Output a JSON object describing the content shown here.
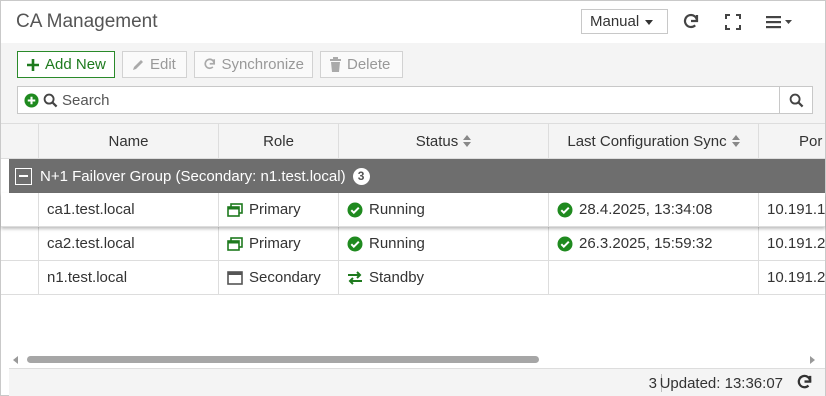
{
  "header": {
    "title": "CA Management",
    "mode_selected": "Manual",
    "icons": [
      "refresh-icon",
      "fullscreen-icon",
      "menu-icon"
    ]
  },
  "toolbar": {
    "add_label": "Add New",
    "edit_label": "Edit",
    "sync_label": "Synchronize",
    "delete_label": "Delete",
    "search_placeholder": "Search"
  },
  "table": {
    "columns": [
      "Name",
      "Role",
      "Status",
      "Last Configuration Sync",
      "Por"
    ],
    "group": {
      "label": "N+1 Failover Group (Secondary: n1.test.local)",
      "count": "3"
    },
    "rows": [
      {
        "name": "ca1.test.local",
        "role": "Primary",
        "role_icon": "windows-stack-icon",
        "status": "Running",
        "status_icon": "check-circle-icon",
        "sync": "28.4.2025, 13:34:08",
        "port": "10.191.1"
      },
      {
        "name": "ca2.test.local",
        "role": "Primary",
        "role_icon": "windows-stack-icon",
        "status": "Running",
        "status_icon": "check-circle-icon",
        "sync": "26.3.2025, 15:59:32",
        "port": "10.191.2"
      },
      {
        "name": "n1.test.local",
        "role": "Secondary",
        "role_icon": "window-icon",
        "status": "Standby",
        "status_icon": "swap-arrows-icon",
        "sync": "",
        "port": "10.191.2"
      }
    ]
  },
  "footer": {
    "count": "3",
    "updated": "Updated: 13:36:07"
  },
  "colors": {
    "accent_green": "#1e7a1e",
    "group_bar": "#6e6e6e",
    "check_green": "#1f8a1f"
  }
}
